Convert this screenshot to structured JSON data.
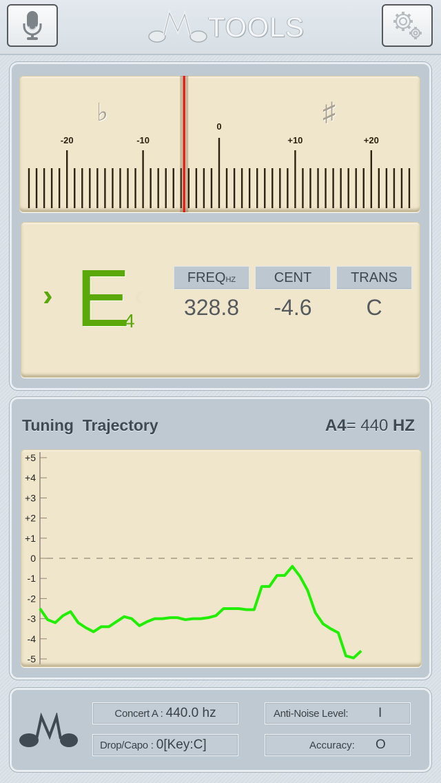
{
  "header": {
    "app_title": "TOOLS",
    "mic_button_icon": "microphone-icon",
    "settings_button_icon": "gears-icon"
  },
  "meter": {
    "flat_symbol": "♭",
    "sharp_symbol": "♯",
    "scale_min": -25,
    "scale_max": 25,
    "labels": [
      {
        "value": -20,
        "text": "-20"
      },
      {
        "value": -10,
        "text": "-10"
      },
      {
        "value": 0,
        "text": "0"
      },
      {
        "value": 10,
        "text": "+10"
      },
      {
        "value": 20,
        "text": "+20"
      }
    ],
    "needle_cents": -4.6,
    "needle_color": "#ee1111"
  },
  "note": {
    "name": "E",
    "octave": "4",
    "left_indicator": "›",
    "right_indicator": "‹",
    "color": "#5aa80a",
    "columns": [
      {
        "header": "FREQ",
        "header_sub": "HZ",
        "value": "328.8"
      },
      {
        "header": "CENT",
        "header_sub": "",
        "value": "-4.6"
      },
      {
        "header": "TRANS",
        "header_sub": "",
        "value": "C"
      }
    ]
  },
  "trajectory": {
    "title": "Tuning  Trajectory",
    "a4_label": "A4",
    "a4_eq": "=",
    "a4_value": "440",
    "a4_unit": "HZ"
  },
  "chart_data": {
    "type": "line",
    "title": "Tuning Trajectory",
    "xlabel": "",
    "ylabel": "",
    "ylim": [
      -5,
      5
    ],
    "yticks": [
      "+5",
      "+4",
      "+3",
      "+2",
      "+1",
      "0",
      "-1",
      "-2",
      "-3",
      "-4",
      "-5"
    ],
    "ytick_values": [
      5,
      4,
      3,
      2,
      1,
      0,
      -1,
      -2,
      -3,
      -4,
      -5
    ],
    "reference_line": 0,
    "grid": false,
    "line_color": "#22ee00",
    "series": [
      {
        "name": "cents",
        "values": [
          -2.5,
          -3.05,
          -3.2,
          -2.85,
          -2.65,
          -3.2,
          -3.45,
          -3.65,
          -3.4,
          -3.4,
          -3.15,
          -2.9,
          -3.0,
          -3.35,
          -3.15,
          -3.0,
          -3.0,
          -2.95,
          -2.95,
          -3.05,
          -3.0,
          -3.0,
          -2.95,
          -2.85,
          -2.5,
          -2.5,
          -2.5,
          -2.55,
          -2.55,
          -1.4,
          -1.4,
          -0.85,
          -0.85,
          -0.4,
          -0.9,
          -1.6,
          -2.7,
          -3.25,
          -3.5,
          -3.7,
          -4.85,
          -4.95,
          -4.6
        ]
      }
    ]
  },
  "footer": {
    "concert_a_label": "Concert A :",
    "concert_a_value": "440.0 hz",
    "drop_capo_label": "Drop/Capo :",
    "drop_capo_value": "0[Key:C]",
    "anti_noise_label": "Anti-Noise Level:",
    "anti_noise_value": "I",
    "accuracy_label": "Accuracy:",
    "accuracy_value": "O"
  }
}
